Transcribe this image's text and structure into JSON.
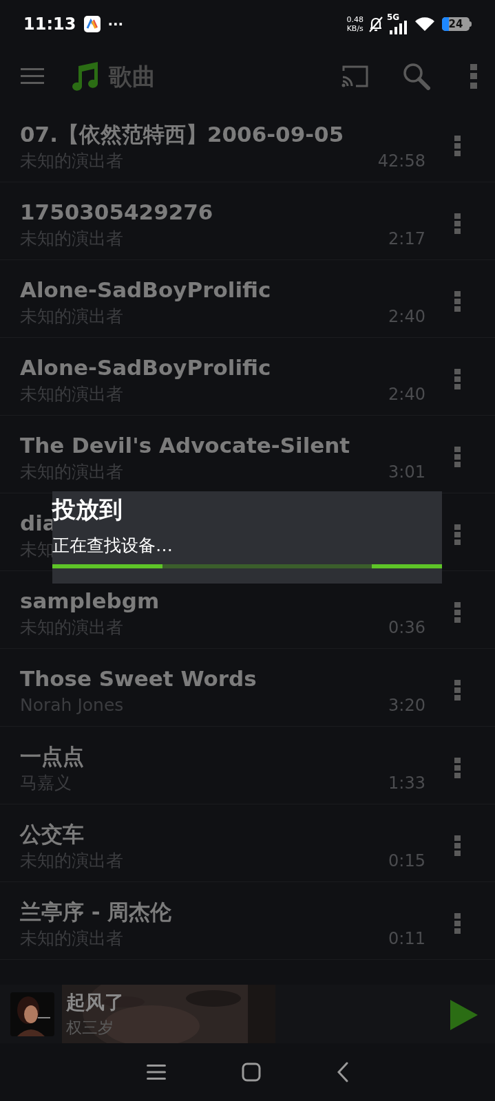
{
  "status_bar": {
    "time": "11:13",
    "dots": "···",
    "speed": "0.48",
    "speed_unit": "KB/s",
    "network": "5G",
    "battery": "24"
  },
  "toolbar": {
    "title": "歌曲"
  },
  "songs": [
    {
      "title": "07.【依然范特西】2006-09-05",
      "artist": "未知的演出者",
      "duration": "42:58"
    },
    {
      "title": "1750305429276",
      "artist": "未知的演出者",
      "duration": "2:17"
    },
    {
      "title": "Alone-SadBoyProlific",
      "artist": "未知的演出者",
      "duration": "2:40"
    },
    {
      "title": "Alone-SadBoyProlific",
      "artist": "未知的演出者",
      "duration": "2:40"
    },
    {
      "title": "The Devil's Advocate-Silent",
      "artist": "未知的演出者",
      "duration": "3:01"
    },
    {
      "title": "dia",
      "artist": "未知"
    },
    {
      "title": "samplebgm",
      "artist": "未知的演出者",
      "duration": "0:36"
    },
    {
      "title": "Those Sweet Words",
      "artist": "Norah Jones",
      "duration": "3:20"
    },
    {
      "title": "一点点",
      "artist": "马嘉义",
      "duration": "1:33"
    },
    {
      "title": "公交车",
      "artist": "未知的演出者",
      "duration": "0:15"
    },
    {
      "title": "兰亭序 - 周杰伦",
      "artist": "未知的演出者",
      "duration": "0:11"
    }
  ],
  "dialog": {
    "title": "投放到",
    "message": "正在查找设备…",
    "indeterminate": true
  },
  "now_playing": {
    "title": "起风了",
    "artist": "权三岁"
  }
}
